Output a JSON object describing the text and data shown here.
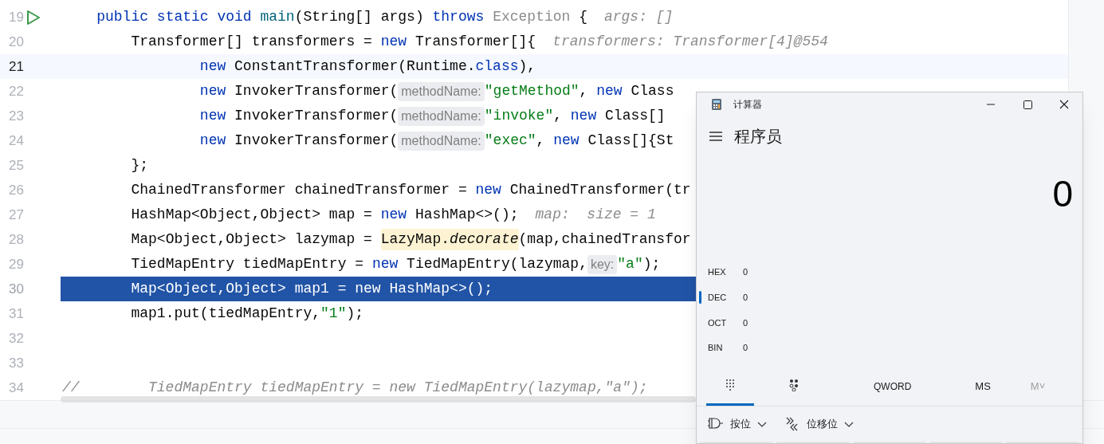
{
  "editor": {
    "lines": [
      {
        "number": "19",
        "run_icon": true,
        "current": false,
        "execution_point": false,
        "segments": [
          {
            "kind": "keyword",
            "text": "    public static void "
          },
          {
            "kind": "method",
            "text": "main"
          },
          {
            "kind": "plain",
            "text": "(String[] args) "
          },
          {
            "kind": "keyword",
            "text": "throws "
          },
          {
            "kind": "unused",
            "text": "Exception"
          },
          {
            "kind": "plain",
            "text": " {"
          },
          {
            "kind": "inline_value",
            "text": "args: []"
          }
        ]
      },
      {
        "number": "20",
        "run_icon": false,
        "current": false,
        "execution_point": false,
        "segments": [
          {
            "kind": "plain",
            "text": "        Transformer[] transformers = "
          },
          {
            "kind": "keyword",
            "text": "new "
          },
          {
            "kind": "plain",
            "text": "Transformer[]{"
          },
          {
            "kind": "inline_value",
            "text": "transformers: Transformer[4]@554"
          }
        ]
      },
      {
        "number": "21",
        "run_icon": false,
        "current": true,
        "execution_point": false,
        "segments": [
          {
            "kind": "keyword",
            "text": "                new "
          },
          {
            "kind": "plain",
            "text": "ConstantTransformer(Runtime."
          },
          {
            "kind": "keyword",
            "text": "class"
          },
          {
            "kind": "plain",
            "text": "),"
          }
        ]
      },
      {
        "number": "22",
        "run_icon": false,
        "current": false,
        "execution_point": false,
        "segments": [
          {
            "kind": "keyword",
            "text": "                new "
          },
          {
            "kind": "plain",
            "text": "InvokerTransformer("
          },
          {
            "kind": "param_hint",
            "text": "methodName:"
          },
          {
            "kind": "string",
            "text": "\"getMethod\""
          },
          {
            "kind": "plain",
            "text": ", "
          },
          {
            "kind": "keyword",
            "text": "new "
          },
          {
            "kind": "plain",
            "text": "Class"
          }
        ]
      },
      {
        "number": "23",
        "run_icon": false,
        "current": false,
        "execution_point": false,
        "segments": [
          {
            "kind": "keyword",
            "text": "                new "
          },
          {
            "kind": "plain",
            "text": "InvokerTransformer("
          },
          {
            "kind": "param_hint",
            "text": "methodName:"
          },
          {
            "kind": "string",
            "text": "\"invoke\""
          },
          {
            "kind": "plain",
            "text": ", "
          },
          {
            "kind": "keyword",
            "text": "new "
          },
          {
            "kind": "plain",
            "text": "Class[]"
          }
        ]
      },
      {
        "number": "24",
        "run_icon": false,
        "current": false,
        "execution_point": false,
        "segments": [
          {
            "kind": "keyword",
            "text": "                new "
          },
          {
            "kind": "plain",
            "text": "InvokerTransformer("
          },
          {
            "kind": "param_hint",
            "text": "methodName:"
          },
          {
            "kind": "string",
            "text": "\"exec\""
          },
          {
            "kind": "plain",
            "text": ", "
          },
          {
            "kind": "keyword",
            "text": "new "
          },
          {
            "kind": "plain",
            "text": "Class[]{St"
          }
        ]
      },
      {
        "number": "25",
        "run_icon": false,
        "current": false,
        "execution_point": false,
        "segments": [
          {
            "kind": "plain",
            "text": "        };"
          }
        ]
      },
      {
        "number": "26",
        "run_icon": false,
        "current": false,
        "execution_point": false,
        "segments": [
          {
            "kind": "plain",
            "text": "        ChainedTransformer chainedTransformer = "
          },
          {
            "kind": "keyword",
            "text": "new "
          },
          {
            "kind": "plain",
            "text": "ChainedTransformer(tr"
          }
        ]
      },
      {
        "number": "27",
        "run_icon": false,
        "current": false,
        "execution_point": false,
        "segments": [
          {
            "kind": "plain",
            "text": "        HashMap<Object,Object> map = "
          },
          {
            "kind": "keyword",
            "text": "new "
          },
          {
            "kind": "plain",
            "text": "HashMap<>();"
          },
          {
            "kind": "inline_value",
            "text": "map:  size = 1"
          }
        ]
      },
      {
        "number": "28",
        "run_icon": false,
        "current": false,
        "execution_point": false,
        "segments": [
          {
            "kind": "plain",
            "text": "        Map<Object,Object> lazymap = "
          },
          {
            "kind": "highlighted",
            "text": "LazyMap."
          },
          {
            "kind": "highlighted_italic",
            "text": "decorate"
          },
          {
            "kind": "plain",
            "text": "(map,chainedTransfor"
          }
        ]
      },
      {
        "number": "29",
        "run_icon": false,
        "current": false,
        "execution_point": false,
        "segments": [
          {
            "kind": "plain",
            "text": "        TiedMapEntry tiedMapEntry = "
          },
          {
            "kind": "keyword",
            "text": "new "
          },
          {
            "kind": "plain",
            "text": "TiedMapEntry(lazymap,"
          },
          {
            "kind": "param_hint",
            "text": "key:"
          },
          {
            "kind": "string",
            "text": "\"a\""
          },
          {
            "kind": "plain",
            "text": ");"
          }
        ]
      },
      {
        "number": "30",
        "run_icon": false,
        "current": false,
        "execution_point": true,
        "segments": [
          {
            "kind": "plain",
            "text": "        Map<Object,Object> map1 = new HashMap<>();"
          }
        ]
      },
      {
        "number": "31",
        "run_icon": false,
        "current": false,
        "execution_point": false,
        "segments": [
          {
            "kind": "plain",
            "text": "        map1.put(tiedMapEntry,"
          },
          {
            "kind": "string",
            "text": "\"1\""
          },
          {
            "kind": "plain",
            "text": ");"
          }
        ]
      },
      {
        "number": "32",
        "run_icon": false,
        "current": false,
        "execution_point": false
      },
      {
        "number": "33",
        "run_icon": false,
        "current": false,
        "execution_point": false
      },
      {
        "number": "34",
        "run_icon": false,
        "current": false,
        "execution_point": false,
        "segments": [
          {
            "kind": "comment",
            "text": "//        TiedMapEntry tiedMapEntry = new TiedMapEntry(lazymap,\"a\");"
          }
        ]
      }
    ]
  },
  "calculator": {
    "title": "计算器",
    "mode": "程序员",
    "display": "0",
    "bases": [
      {
        "label": "HEX",
        "value": "0",
        "selected": false
      },
      {
        "label": "DEC",
        "value": "0",
        "selected": true
      },
      {
        "label": "OCT",
        "value": "0",
        "selected": false
      },
      {
        "label": "BIN",
        "value": "0",
        "selected": false
      }
    ],
    "tabs": [
      {
        "kind": "keypad",
        "selected": true
      },
      {
        "kind": "bits",
        "selected": false
      }
    ],
    "word_size": "QWORD",
    "memory": [
      {
        "label": "MS",
        "disabled": false
      },
      {
        "label": "M˅",
        "disabled": true
      }
    ],
    "operations": [
      {
        "kind": "bitwise",
        "label": "按位"
      },
      {
        "kind": "shift",
        "label": "位移位"
      }
    ]
  }
}
